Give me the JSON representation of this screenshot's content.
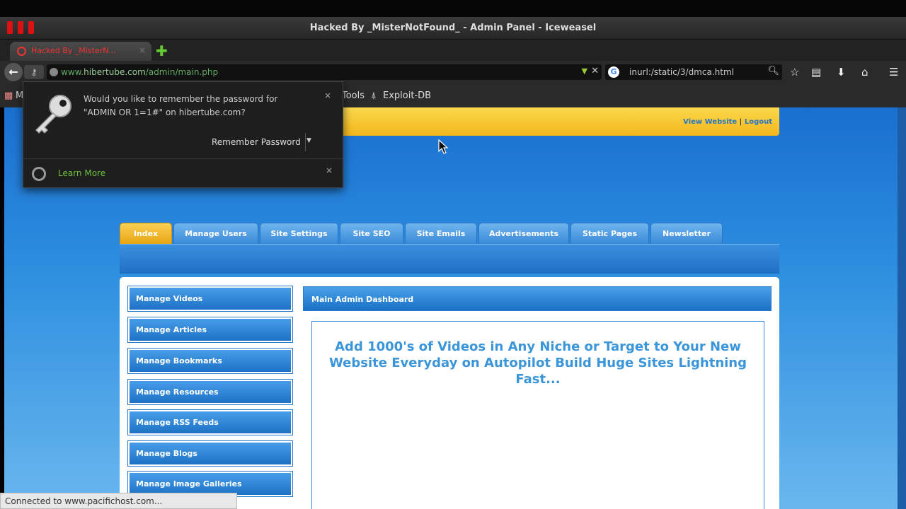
{
  "window": {
    "title": "Hacked By _MisterNotFound_ - Admin Panel - Iceweasel"
  },
  "tab": {
    "label": "Hacked By _MisterN...",
    "close": "×",
    "new_tab": "✚"
  },
  "navbar": {
    "back": "←",
    "url_prefix": "www.",
    "url_domain": "hibertube.com",
    "url_path": "/admin/main.php",
    "url_dropdown": "▼",
    "url_stop": "✕",
    "search_value": "inurl:/static/3/dmca.html",
    "search_engine": "G",
    "icons": [
      "star-icon",
      "reader-icon",
      "download-icon",
      "home-icon",
      "menu-icon"
    ]
  },
  "bookmarks": {
    "left_clip": "M",
    "tools": "Tools",
    "exploit": "Exploit-DB"
  },
  "header": {
    "view_website": "View Website",
    "separator": " | ",
    "logout": "Logout"
  },
  "nav_tabs": [
    "Index",
    "Manage Users",
    "Site Settings",
    "Site SEO",
    "Site Emails",
    "Advertisements",
    "Static Pages",
    "Newsletter"
  ],
  "sidebar": [
    "Manage Videos",
    "Manage Articles",
    "Manage Bookmarks",
    "Manage Resources",
    "Manage RSS Feeds",
    "Manage Blogs",
    "Manage Image Galleries"
  ],
  "dashboard": {
    "title": "Main Admin Dashboard",
    "headline": "Add 1000's of Videos in Any Niche or Target to Your New Website Everyday on Autopilot Build Huge Sites Lightning Fast..."
  },
  "popup": {
    "message": "Would you like to remember the password for \"ADMIN OR 1=1#\" on hibertube.com?",
    "remember_button": "Remember Password",
    "learn_more": "Learn More",
    "close": "×"
  },
  "status": {
    "text": "Connected to www.pacifichost.com..."
  },
  "colors": {
    "accent_blue": "#1a6fc4",
    "accent_gold": "#f2b71c",
    "link_green": "#6cbf3a"
  }
}
